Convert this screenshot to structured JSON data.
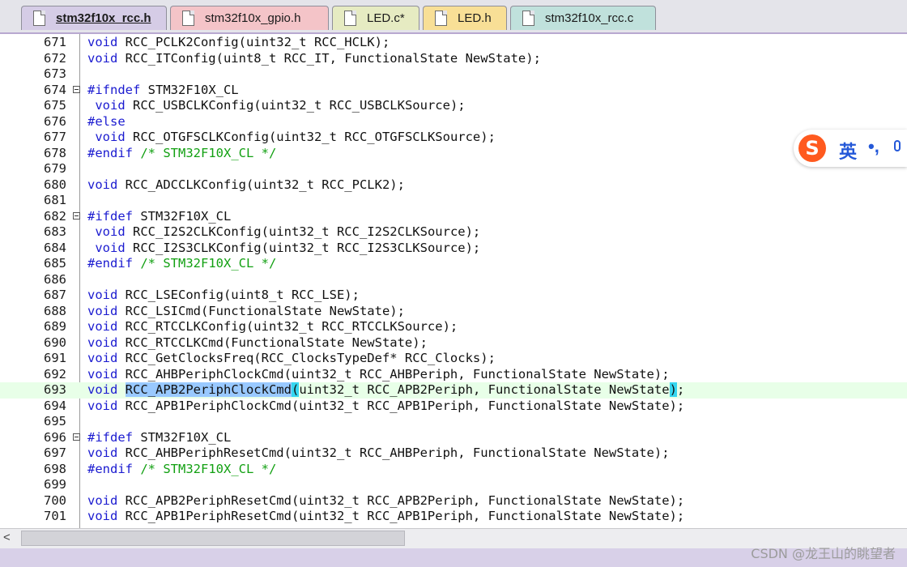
{
  "tabs": [
    {
      "label": "stm32f10x_rcc.h",
      "active": true,
      "color": "#d5cce6"
    },
    {
      "label": "stm32f10x_gpio.h",
      "active": false,
      "color": "#f4c4c8"
    },
    {
      "label": "LED.c*",
      "active": false,
      "color": "#e6ebc2"
    },
    {
      "label": "LED.h",
      "active": false,
      "color": "#f8df96"
    },
    {
      "label": "stm32f10x_rcc.c",
      "active": false,
      "color": "#c0e1dc"
    }
  ],
  "code_lines": [
    {
      "n": "671",
      "fold": false,
      "highlight": false,
      "tokens": [
        {
          "t": "kw",
          "v": "void"
        },
        {
          "t": "tx",
          "v": " RCC_PCLK2Config(uint32_t RCC_HCLK);"
        }
      ]
    },
    {
      "n": "672",
      "fold": false,
      "highlight": false,
      "tokens": [
        {
          "t": "kw",
          "v": "void"
        },
        {
          "t": "tx",
          "v": " RCC_ITConfig(uint8_t RCC_IT, FunctionalState NewState);"
        }
      ]
    },
    {
      "n": "673",
      "fold": false,
      "highlight": false,
      "tokens": []
    },
    {
      "n": "674",
      "fold": true,
      "highlight": false,
      "tokens": [
        {
          "t": "pp",
          "v": "#ifndef"
        },
        {
          "t": "tx",
          "v": " STM32F10X_CL"
        }
      ]
    },
    {
      "n": "675",
      "fold": false,
      "highlight": false,
      "tokens": [
        {
          "t": "tx",
          "v": " "
        },
        {
          "t": "kw",
          "v": "void"
        },
        {
          "t": "tx",
          "v": " RCC_USBCLKConfig(uint32_t RCC_USBCLKSource);"
        }
      ]
    },
    {
      "n": "676",
      "fold": false,
      "highlight": false,
      "tokens": [
        {
          "t": "pp",
          "v": "#else"
        }
      ]
    },
    {
      "n": "677",
      "fold": false,
      "highlight": false,
      "tokens": [
        {
          "t": "tx",
          "v": " "
        },
        {
          "t": "kw",
          "v": "void"
        },
        {
          "t": "tx",
          "v": " RCC_OTGFSCLKConfig(uint32_t RCC_OTGFSCLKSource);"
        }
      ]
    },
    {
      "n": "678",
      "fold": false,
      "highlight": false,
      "tokens": [
        {
          "t": "pp",
          "v": "#endif"
        },
        {
          "t": "tx",
          "v": " "
        },
        {
          "t": "cm",
          "v": "/* STM32F10X_CL */"
        }
      ]
    },
    {
      "n": "679",
      "fold": false,
      "highlight": false,
      "tokens": []
    },
    {
      "n": "680",
      "fold": false,
      "highlight": false,
      "tokens": [
        {
          "t": "kw",
          "v": "void"
        },
        {
          "t": "tx",
          "v": " RCC_ADCCLKConfig(uint32_t RCC_PCLK2);"
        }
      ]
    },
    {
      "n": "681",
      "fold": false,
      "highlight": false,
      "tokens": []
    },
    {
      "n": "682",
      "fold": true,
      "highlight": false,
      "tokens": [
        {
          "t": "pp",
          "v": "#ifdef"
        },
        {
          "t": "tx",
          "v": " STM32F10X_CL"
        }
      ]
    },
    {
      "n": "683",
      "fold": false,
      "highlight": false,
      "tokens": [
        {
          "t": "tx",
          "v": " "
        },
        {
          "t": "kw",
          "v": "void"
        },
        {
          "t": "tx",
          "v": " RCC_I2S2CLKConfig(uint32_t RCC_I2S2CLKSource);"
        }
      ]
    },
    {
      "n": "684",
      "fold": false,
      "highlight": false,
      "tokens": [
        {
          "t": "tx",
          "v": " "
        },
        {
          "t": "kw",
          "v": "void"
        },
        {
          "t": "tx",
          "v": " RCC_I2S3CLKConfig(uint32_t RCC_I2S3CLKSource);"
        }
      ]
    },
    {
      "n": "685",
      "fold": false,
      "highlight": false,
      "tokens": [
        {
          "t": "pp",
          "v": "#endif"
        },
        {
          "t": "tx",
          "v": " "
        },
        {
          "t": "cm",
          "v": "/* STM32F10X_CL */"
        }
      ]
    },
    {
      "n": "686",
      "fold": false,
      "highlight": false,
      "tokens": []
    },
    {
      "n": "687",
      "fold": false,
      "highlight": false,
      "tokens": [
        {
          "t": "kw",
          "v": "void"
        },
        {
          "t": "tx",
          "v": " RCC_LSEConfig(uint8_t RCC_LSE);"
        }
      ]
    },
    {
      "n": "688",
      "fold": false,
      "highlight": false,
      "tokens": [
        {
          "t": "kw",
          "v": "void"
        },
        {
          "t": "tx",
          "v": " RCC_LSICmd(FunctionalState NewState);"
        }
      ]
    },
    {
      "n": "689",
      "fold": false,
      "highlight": false,
      "tokens": [
        {
          "t": "kw",
          "v": "void"
        },
        {
          "t": "tx",
          "v": " RCC_RTCCLKConfig(uint32_t RCC_RTCCLKSource);"
        }
      ]
    },
    {
      "n": "690",
      "fold": false,
      "highlight": false,
      "tokens": [
        {
          "t": "kw",
          "v": "void"
        },
        {
          "t": "tx",
          "v": " RCC_RTCCLKCmd(FunctionalState NewState);"
        }
      ]
    },
    {
      "n": "691",
      "fold": false,
      "highlight": false,
      "tokens": [
        {
          "t": "kw",
          "v": "void"
        },
        {
          "t": "tx",
          "v": " RCC_GetClocksFreq(RCC_ClocksTypeDef* RCC_Clocks);"
        }
      ]
    },
    {
      "n": "692",
      "fold": false,
      "highlight": false,
      "tokens": [
        {
          "t": "kw",
          "v": "void"
        },
        {
          "t": "tx",
          "v": " RCC_AHBPeriphClockCmd(uint32_t RCC_AHBPeriph, FunctionalState NewState);"
        }
      ]
    },
    {
      "n": "693",
      "fold": false,
      "highlight": true,
      "tokens": [
        {
          "t": "kw",
          "v": "void"
        },
        {
          "t": "tx",
          "v": " "
        },
        {
          "t": "sel",
          "v": "RCC_APB2PeriphClockCmd"
        },
        {
          "t": "br",
          "v": "("
        },
        {
          "t": "tx",
          "v": "uint32_t RCC_APB2Periph, FunctionalState NewState"
        },
        {
          "t": "br",
          "v": ")"
        },
        {
          "t": "tx",
          "v": ";"
        }
      ]
    },
    {
      "n": "694",
      "fold": false,
      "highlight": false,
      "tokens": [
        {
          "t": "kw",
          "v": "void"
        },
        {
          "t": "tx",
          "v": " RCC_APB1PeriphClockCmd(uint32_t RCC_APB1Periph, FunctionalState NewState);"
        }
      ]
    },
    {
      "n": "695",
      "fold": false,
      "highlight": false,
      "tokens": []
    },
    {
      "n": "696",
      "fold": true,
      "highlight": false,
      "tokens": [
        {
          "t": "pp",
          "v": "#ifdef"
        },
        {
          "t": "tx",
          "v": " STM32F10X_CL"
        }
      ]
    },
    {
      "n": "697",
      "fold": false,
      "highlight": false,
      "tokens": [
        {
          "t": "kw",
          "v": "void"
        },
        {
          "t": "tx",
          "v": " RCC_AHBPeriphResetCmd(uint32_t RCC_AHBPeriph, FunctionalState NewState);"
        }
      ]
    },
    {
      "n": "698",
      "fold": false,
      "highlight": false,
      "tokens": [
        {
          "t": "pp",
          "v": "#endif"
        },
        {
          "t": "tx",
          "v": " "
        },
        {
          "t": "cm",
          "v": "/* STM32F10X_CL */"
        }
      ]
    },
    {
      "n": "699",
      "fold": false,
      "highlight": false,
      "tokens": []
    },
    {
      "n": "700",
      "fold": false,
      "highlight": false,
      "tokens": [
        {
          "t": "kw",
          "v": "void"
        },
        {
          "t": "tx",
          "v": " RCC_APB2PeriphResetCmd(uint32_t RCC_APB2Periph, FunctionalState NewState);"
        }
      ]
    },
    {
      "n": "701",
      "fold": false,
      "highlight": false,
      "tokens": [
        {
          "t": "kw",
          "v": "void"
        },
        {
          "t": "tx",
          "v": " RCC_APB1PeriphResetCmd(uint32_t RCC_APB1Periph, FunctionalState NewState);"
        }
      ]
    }
  ],
  "ime": {
    "logo_glyph": "S",
    "mode": "英",
    "punct": "•,"
  },
  "scrollbar": {
    "left_arrow": "<"
  },
  "watermark": "CSDN @龙王山的眺望者"
}
